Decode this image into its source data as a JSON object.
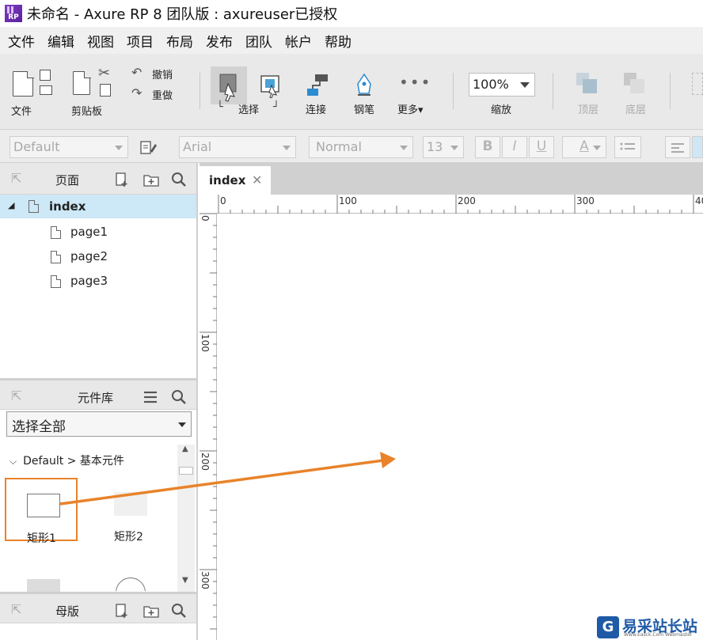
{
  "window": {
    "title": "未命名 - Axure RP 8 团队版 : axureuser已授权",
    "logo_text": "RP"
  },
  "menu": [
    "文件",
    "编辑",
    "视图",
    "项目",
    "布局",
    "发布",
    "团队",
    "帐户",
    "帮助"
  ],
  "toolbar": {
    "file_label": "文件",
    "clipboard_label": "剪贴板",
    "undo_label": "撤销",
    "redo_label": "重做",
    "select_label": "选择",
    "connect_label": "连接",
    "pen_label": "钢笔",
    "more_label": "更多▾",
    "zoom_value": "100%",
    "zoom_label": "缩放",
    "front_label": "顶层",
    "back_label": "底层"
  },
  "formatbar": {
    "style": "Default",
    "font": "Arial",
    "weight": "Normal",
    "size": "13",
    "bold": "B",
    "italic": "I",
    "underline": "U",
    "color_glyph": "A"
  },
  "pages_panel": {
    "title": "页面",
    "root": "index",
    "children": [
      "page1",
      "page2",
      "page3"
    ]
  },
  "library_panel": {
    "title": "元件库",
    "selector": "选择全部",
    "group": "Default > 基本元件",
    "items": [
      "矩形1",
      "矩形2"
    ]
  },
  "masters_panel": {
    "title": "母版"
  },
  "canvas": {
    "tab_label": "index",
    "ruler_h": [
      "0",
      "100",
      "200",
      "300",
      "40"
    ],
    "ruler_v": [
      "0",
      "100",
      "200",
      "300"
    ]
  },
  "watermark": {
    "text": "易采站长站",
    "sub": "Www.Easck.Com Webmaster"
  },
  "colors": {
    "highlight": "#e8832a",
    "selection": "#cde8f7"
  }
}
